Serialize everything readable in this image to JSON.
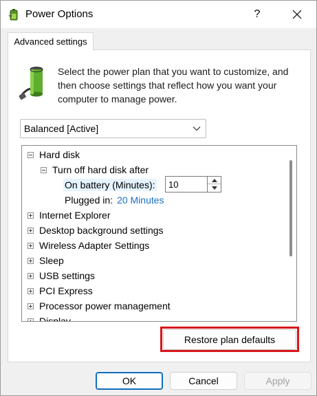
{
  "window": {
    "title": "Power Options",
    "help_glyph": "?",
    "tab_label": "Advanced settings"
  },
  "description": "Select the power plan that you want to customize, and then choose settings that reflect how you want your computer to manage power.",
  "plan_select": {
    "selected": "Balanced [Active]"
  },
  "tree": {
    "hard_disk": "Hard disk",
    "turn_off": "Turn off hard disk after",
    "on_battery_label": "On battery (Minutes):",
    "on_battery_value": "10",
    "plugged_in_label": "Plugged in:",
    "plugged_in_value": "20 Minutes",
    "items": [
      "Internet Explorer",
      "Desktop background settings",
      "Wireless Adapter Settings",
      "Sleep",
      "USB settings",
      "PCI Express",
      "Processor power management",
      "Display"
    ]
  },
  "buttons": {
    "restore": "Restore plan defaults",
    "ok": "OK",
    "cancel": "Cancel",
    "apply": "Apply"
  },
  "colors": {
    "highlight": "#d7161b",
    "link": "#1a6ec4",
    "ok_border": "#0f6cbd"
  },
  "icons": {
    "title": "power-options-icon",
    "battery": "battery-plug-icon",
    "close": "close-icon",
    "dropdown": "chevron-down-icon"
  }
}
